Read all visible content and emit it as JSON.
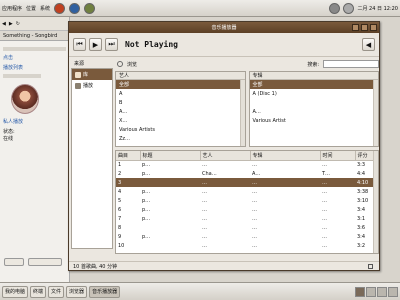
{
  "top_panel": {
    "menus": [
      "应用程序",
      "位置",
      "系统"
    ],
    "clock": "二月 24 日 12:20"
  },
  "browser": {
    "tab_label": "Something - Songbird",
    "links": [
      "点击",
      "播放列表",
      "私人播放"
    ],
    "status_lines": [
      "状态:",
      "在线"
    ]
  },
  "player": {
    "title": "音乐播放器",
    "now_playing": "Not Playing",
    "source_header": "来源",
    "sources": [
      {
        "label": "库",
        "selected": true
      },
      {
        "label": "播放",
        "selected": false
      }
    ],
    "search_label": "搜索:",
    "search_value": "",
    "artist_pane": {
      "header": "艺人",
      "rows": [
        "全部",
        "A",
        "B",
        "A…",
        "X…",
        "Various Artists",
        "Zz…"
      ],
      "selected_index": 0
    },
    "album_pane": {
      "header": "专辑",
      "rows": [
        "全部",
        "A (Disc 1)",
        "",
        "A…",
        "Various Artist"
      ],
      "selected_index": 0
    },
    "track_columns": [
      "曲目",
      "标题",
      "艺人",
      "专辑",
      "时间",
      "评分"
    ],
    "tracks": [
      {
        "num": "1",
        "title": "p…",
        "artist": "…",
        "album": "…",
        "time": "…",
        "rating": "3:3"
      },
      {
        "num": "2",
        "title": "p…",
        "artist": "Cha…",
        "album": "A…",
        "time": "T…",
        "rating": "4:4"
      },
      {
        "num": "3",
        "title": "",
        "artist": "…",
        "album": "…",
        "time": "…",
        "rating": "4:10"
      },
      {
        "num": "4",
        "title": "p…",
        "artist": "…",
        "album": "…",
        "time": "…",
        "rating": "3:38"
      },
      {
        "num": "5",
        "title": "p…",
        "artist": "…",
        "album": "…",
        "time": "…",
        "rating": "3:10"
      },
      {
        "num": "6",
        "title": "p…",
        "artist": "…",
        "album": "…",
        "time": "…",
        "rating": "3:4"
      },
      {
        "num": "7",
        "title": "p…",
        "artist": "…",
        "album": "…",
        "time": "…",
        "rating": "3:1"
      },
      {
        "num": "8",
        "title": "",
        "artist": "…",
        "album": "…",
        "time": "…",
        "rating": "3:6"
      },
      {
        "num": "9",
        "title": "p…",
        "artist": "…",
        "album": "…",
        "time": "…",
        "rating": "3:4"
      },
      {
        "num": "10",
        "title": "",
        "artist": "…",
        "album": "…",
        "time": "…",
        "rating": "3:2"
      }
    ],
    "selected_track_index": 2,
    "status_text": "10 首歌曲, 40 分钟",
    "browse_label": "浏览"
  },
  "taskbar": {
    "tasks": [
      {
        "label": "我的电脑",
        "active": false
      },
      {
        "label": "终端",
        "active": false
      },
      {
        "label": "文件",
        "active": false
      },
      {
        "label": "浏览器",
        "active": false
      },
      {
        "label": "音乐播放器",
        "active": true
      }
    ]
  },
  "colors": {
    "accent": "#7a5a3c",
    "titlebar": "#5c4026"
  }
}
